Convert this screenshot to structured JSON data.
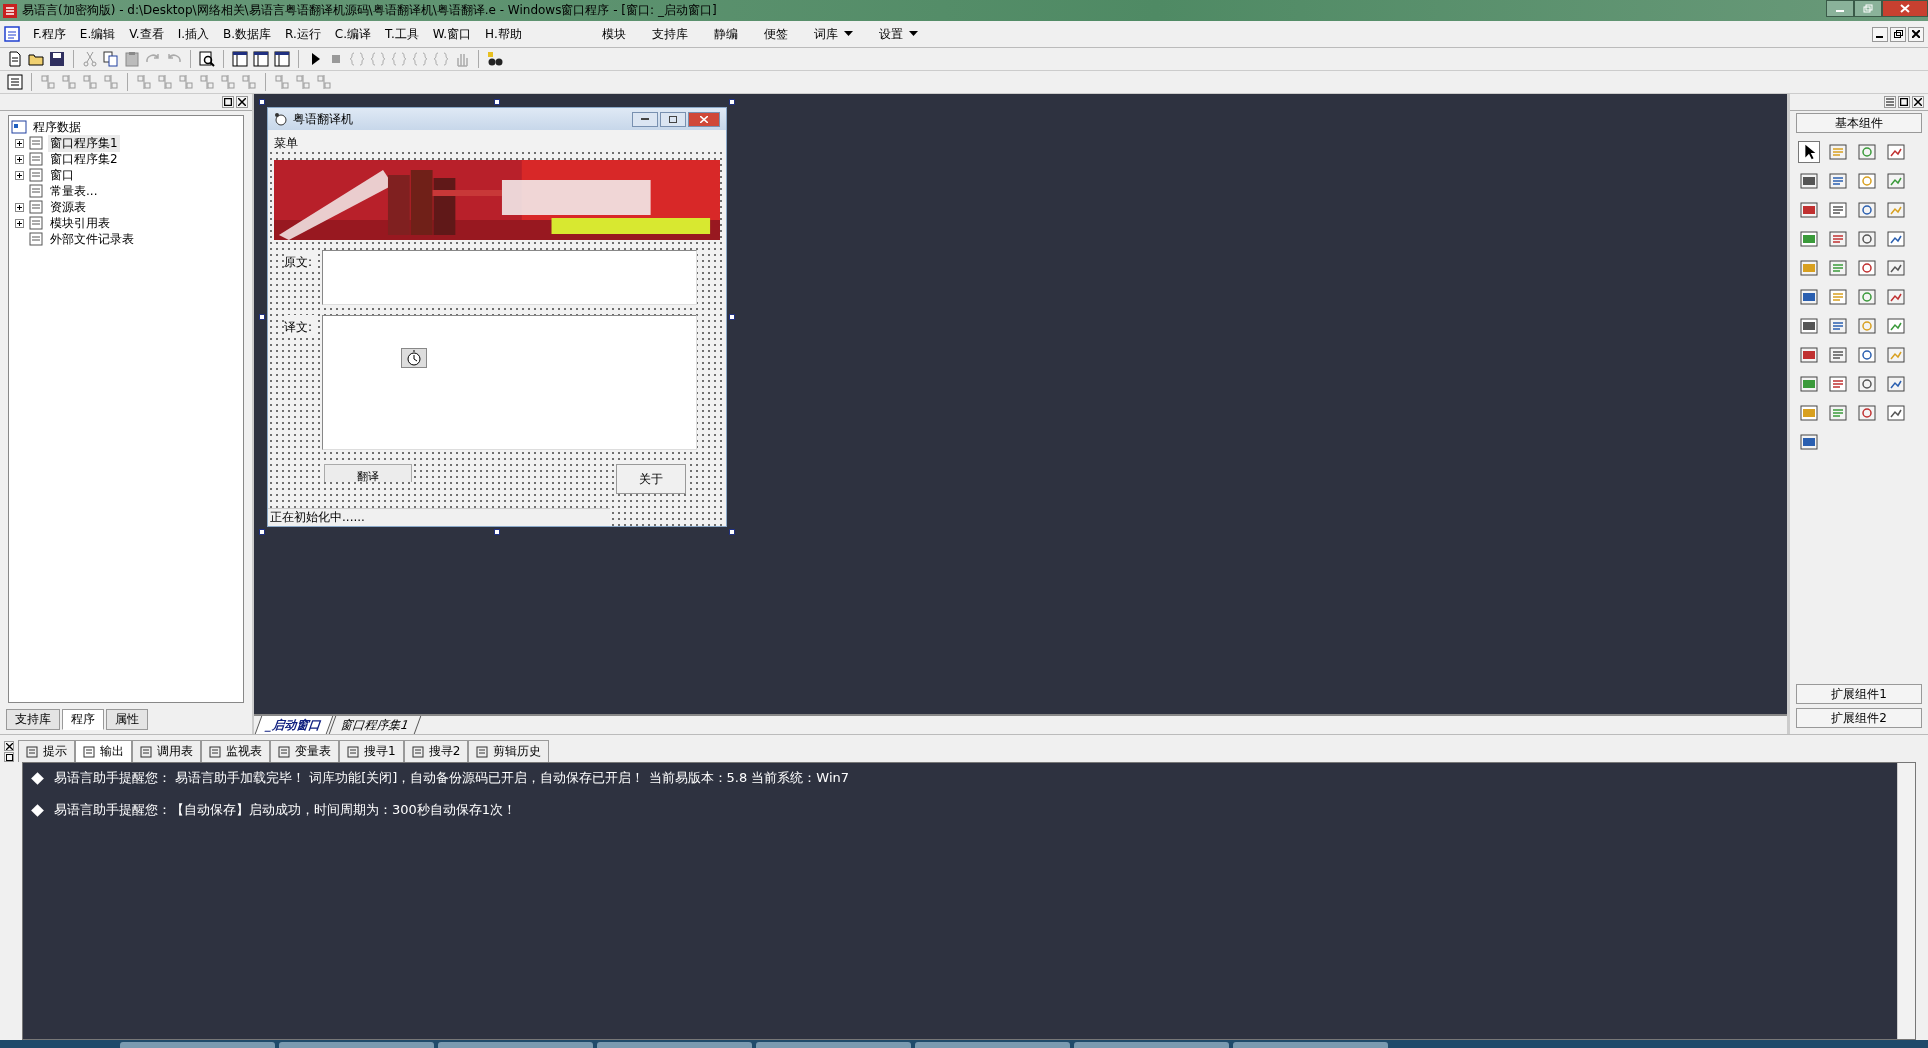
{
  "window": {
    "title": "易语言(加密狗版) - d:\\Desktop\\网络相关\\易语言粤语翻译机源码\\粤语翻译机\\粤语翻译.e - Windows窗口程序 - [窗口: _启动窗口]"
  },
  "menu": [
    "F.程序",
    "E.编辑",
    "V.查看",
    "I.插入",
    "B.数据库",
    "R.运行",
    "C.编译",
    "T.工具",
    "W.窗口",
    "H.帮助"
  ],
  "menu_right": [
    {
      "label": "模块",
      "dropdown": false
    },
    {
      "label": "支持库",
      "dropdown": false
    },
    {
      "label": "静编",
      "dropdown": false
    },
    {
      "label": "便签",
      "dropdown": false
    },
    {
      "label": "词库",
      "dropdown": true
    },
    {
      "label": "设置",
      "dropdown": true
    }
  ],
  "tree": {
    "label": "程序数据",
    "children": [
      {
        "label": "窗口程序集1",
        "expandable": true,
        "selected": true
      },
      {
        "label": "窗口程序集2",
        "expandable": true,
        "selected": false
      },
      {
        "label": "窗口",
        "expandable": true,
        "selected": false
      },
      {
        "label": "常量表...",
        "expandable": false,
        "selected": false
      },
      {
        "label": "资源表",
        "expandable": true,
        "selected": false
      },
      {
        "label": "模块引用表",
        "expandable": true,
        "selected": false
      },
      {
        "label": "外部文件记录表",
        "expandable": false,
        "selected": false
      }
    ]
  },
  "left_tabs": [
    {
      "label": "支持库",
      "selected": false
    },
    {
      "label": "程序",
      "selected": true
    },
    {
      "label": "属性",
      "selected": false
    }
  ],
  "form": {
    "title": "粤语翻译机",
    "menu": "菜单",
    "source_label": "原文:",
    "target_label": "译文:",
    "translate_button": "翻译",
    "about_button": "关于",
    "status": "正在初始化中......"
  },
  "designer_tabs": [
    {
      "label": "_启动窗口",
      "selected": true
    },
    {
      "label": "窗口程序集1",
      "selected": false
    }
  ],
  "toolbox": {
    "header": "基本组件",
    "footer": [
      "扩展组件1",
      "扩展组件2"
    ]
  },
  "output_tabs": [
    {
      "label": "提示",
      "selected": false
    },
    {
      "label": "输出",
      "selected": true
    },
    {
      "label": "调用表",
      "selected": false
    },
    {
      "label": "监视表",
      "selected": false
    },
    {
      "label": "变量表",
      "selected": false
    },
    {
      "label": "搜寻1",
      "selected": false
    },
    {
      "label": "搜寻2",
      "selected": false
    },
    {
      "label": "剪辑历史",
      "selected": false
    }
  ],
  "output_lines": [
    "易语言助手提醒您：  易语言助手加载完毕！  词库功能[关闭]，自动备份源码已开启，自动保存已开启！  当前易版本：5.8  当前系统：Win7",
    "易语言助手提醒您：【自动保存】启动成功，时间周期为：300秒自动保存1次！"
  ]
}
